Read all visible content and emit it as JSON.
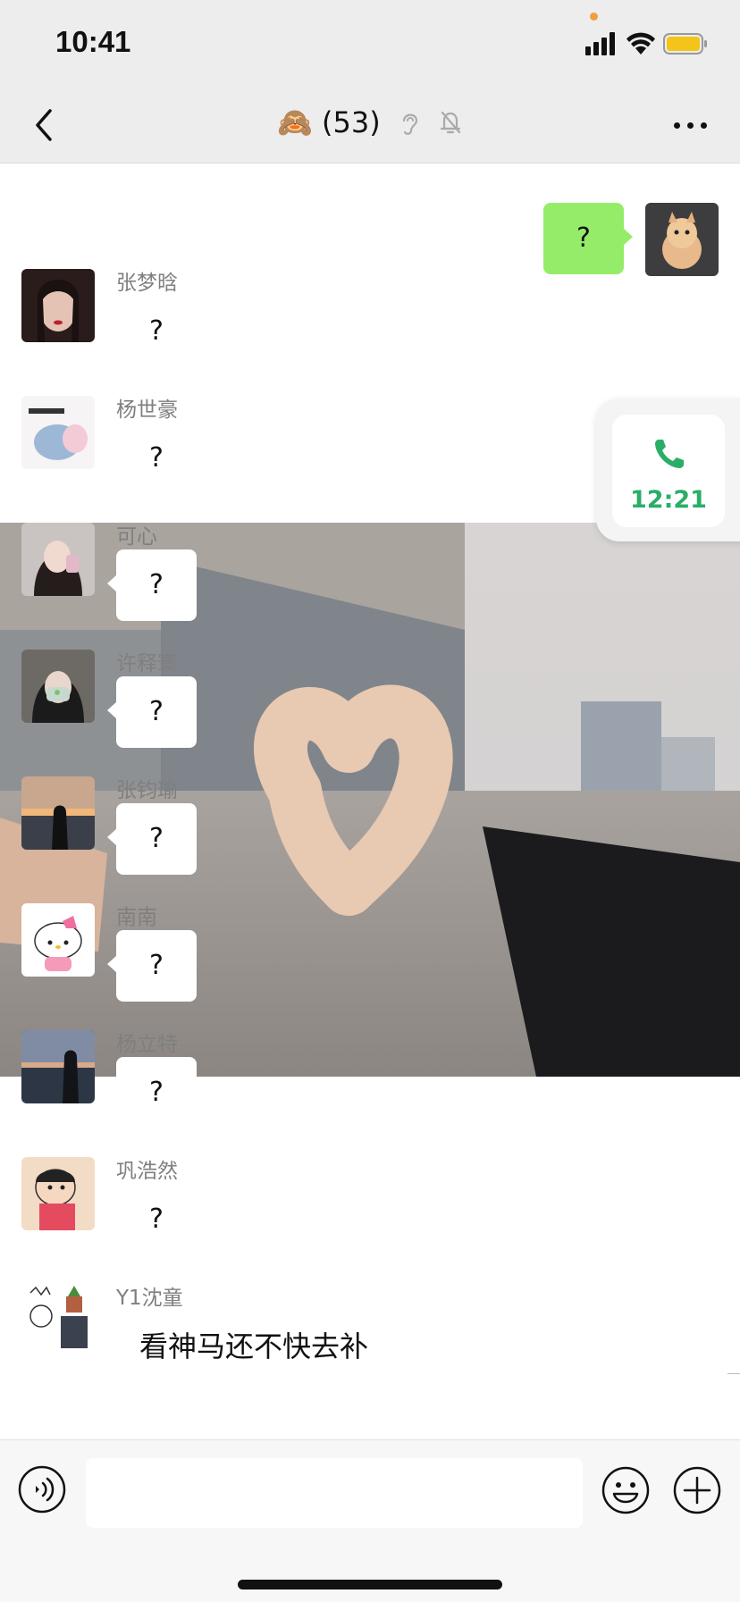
{
  "status_bar": {
    "time": "10:41"
  },
  "header": {
    "title_emoji": "🙈",
    "title_count": "(53)",
    "icons": [
      "ear-icon",
      "muted-bell-icon"
    ]
  },
  "messages": {
    "self": {
      "text": "?"
    },
    "m1": {
      "sender": "张梦晗",
      "text": "?"
    },
    "m2": {
      "sender": "杨世豪",
      "text": "?"
    },
    "m3": {
      "sender": "可心",
      "text": "?"
    },
    "m4": {
      "sender": "许释寰",
      "text": "?"
    },
    "m5": {
      "sender": "张钧瑜",
      "text": "?"
    },
    "m6": {
      "sender": "南南",
      "text": "?"
    },
    "m7": {
      "sender": "杨立特",
      "text": "?"
    },
    "m8": {
      "sender": "巩浩然",
      "text": "?"
    },
    "m9": {
      "sender": "Y1沈童",
      "text": "看神马还不快去补"
    }
  },
  "call_float": {
    "time": "12:21"
  },
  "input_bar": {
    "value": ""
  },
  "colors": {
    "accent": "#95ec69",
    "call_green": "#2aae67",
    "bar_bg": "#ededed"
  }
}
